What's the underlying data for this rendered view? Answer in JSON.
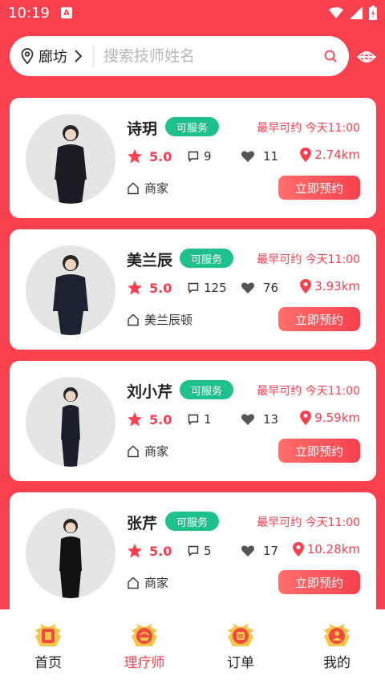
{
  "status_bar": {
    "time": "10:19",
    "notif_letter": "A"
  },
  "search": {
    "city": "廊坊",
    "placeholder": "搜索技师姓名"
  },
  "therapists": [
    {
      "name": "诗玥",
      "status": "可服务",
      "earliest": "最早可约 今天11:00",
      "rating": "5.0",
      "comments": "9",
      "likes": "11",
      "distance": "2.74km",
      "shop": "商家",
      "action": "立即预约"
    },
    {
      "name": "美兰辰",
      "status": "可服务",
      "earliest": "最早可约 今天11:00",
      "rating": "5.0",
      "comments": "125",
      "likes": "76",
      "distance": "3.93km",
      "shop": "美兰辰顿",
      "action": "立即预约"
    },
    {
      "name": "刘小芹",
      "status": "可服务",
      "earliest": "最早可约 今天11:00",
      "rating": "5.0",
      "comments": "1",
      "likes": "13",
      "distance": "9.59km",
      "shop": "商家",
      "action": "立即预约"
    },
    {
      "name": "张芹",
      "status": "可服务",
      "earliest": "最早可约 今天11:00",
      "rating": "5.0",
      "comments": "5",
      "likes": "17",
      "distance": "10.28km",
      "shop": "商家",
      "action": "立即预约"
    }
  ],
  "tabs": [
    {
      "label": "首页",
      "active": false
    },
    {
      "label": "理疗师",
      "active": true
    },
    {
      "label": "订单",
      "active": false
    },
    {
      "label": "我的",
      "active": false
    }
  ],
  "colors": {
    "brand": "#f9404f",
    "badge": "#1ec08c"
  }
}
